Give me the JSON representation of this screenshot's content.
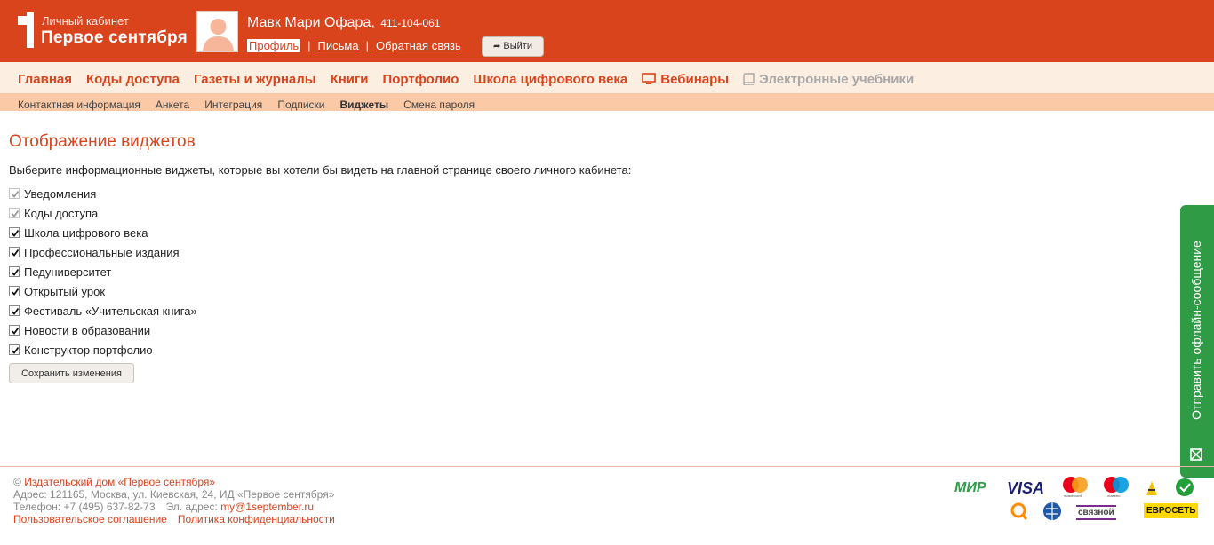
{
  "header": {
    "logo_small": "Личный кабинет",
    "logo_big": "Первое сентября",
    "user_name": "Мавк Мари Офара,",
    "user_id": "411-104-061",
    "links": [
      "Профиль",
      "Письма",
      "Обратная связь"
    ],
    "separator": "|",
    "logout_label": "Выйти"
  },
  "main_nav": {
    "items": [
      "Главная",
      "Коды доступа",
      "Газеты и журналы",
      "Книги",
      "Портфолио",
      "Школа цифрового века",
      "Вебинары",
      "Электронные учебники"
    ]
  },
  "sub_nav": {
    "items": [
      "Контактная информация",
      "Анкета",
      "Интеграция",
      "Подписки",
      "Виджеты",
      "Смена пароля"
    ],
    "active": "Виджеты"
  },
  "content": {
    "title": "Отображение виджетов",
    "intro": "Выберите информационные виджеты, которые вы хотели бы видеть на главной странице своего личного кабинета:",
    "widgets": [
      {
        "label": "Уведомления",
        "checked": true,
        "disabled": true
      },
      {
        "label": "Коды доступа",
        "checked": true,
        "disabled": true
      },
      {
        "label": "Школа цифрового века",
        "checked": true,
        "disabled": false
      },
      {
        "label": "Профессиональные издания",
        "checked": true,
        "disabled": false
      },
      {
        "label": "Педуниверситет",
        "checked": true,
        "disabled": false
      },
      {
        "label": "Открытый урок",
        "checked": true,
        "disabled": false
      },
      {
        "label": "Фестиваль «Учительская книга»",
        "checked": true,
        "disabled": false
      },
      {
        "label": "Новости в образовании",
        "checked": true,
        "disabled": false
      },
      {
        "label": "Конструктор портфолио",
        "checked": true,
        "disabled": false
      }
    ],
    "save_label": "Сохранить изменения"
  },
  "feedback": {
    "label": "Отправить офлайн-сообщение"
  },
  "footer": {
    "copyright_sign": "©",
    "publisher_link": "Издательский дом «Первое сентября»",
    "address": "Адрес: 121165, Москва, ул. Киевская, 24, ИД «Первое сентября»",
    "phone": "Телефон: +7 (495) 637-82-73",
    "email_label": "Эл. адрес:",
    "email": "my@1september.ru",
    "agreement_link": "Пользовательское соглашение",
    "privacy_link": "Политика конфиденциальности"
  },
  "payment_logos": {
    "mir": "МИР",
    "visa": "VISA",
    "mastercard": "mastercard",
    "maestro": "maestro",
    "svyaznoy": "связной",
    "evroset": "ЕВРОСЕТЬ"
  },
  "colors": {
    "brand": "#d9441d",
    "nav_bg": "#fdeee2",
    "subnav_bg": "#fbc9a5",
    "feedback_green": "#2f9b45"
  }
}
